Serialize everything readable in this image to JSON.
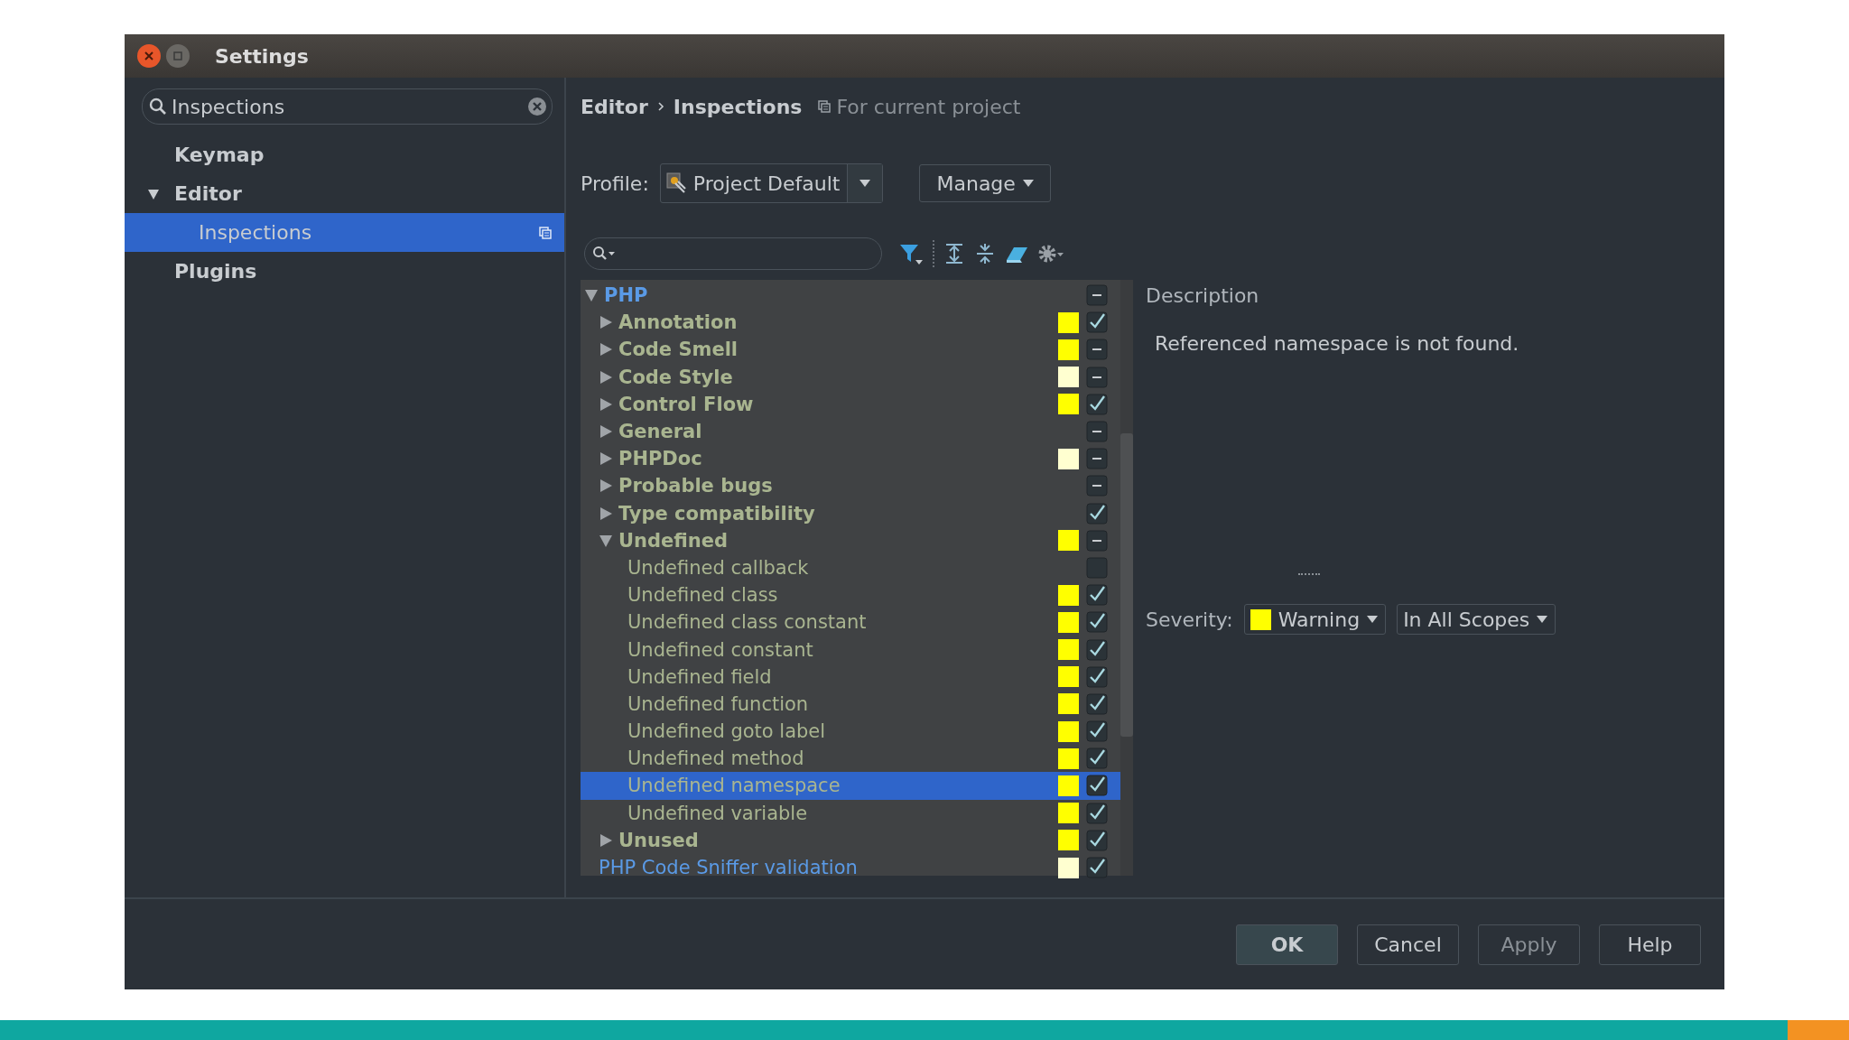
{
  "window": {
    "title": "Settings"
  },
  "sidebar": {
    "search": {
      "value": "Inspections"
    },
    "items": [
      {
        "label": "Keymap",
        "selected": false
      },
      {
        "label": "Editor",
        "selected": false,
        "expanded": true,
        "children": [
          {
            "label": "Inspections",
            "selected": true
          }
        ]
      },
      {
        "label": "Plugins",
        "selected": false
      }
    ]
  },
  "breadcrumb": [
    "Editor",
    "Inspections"
  ],
  "scope_note": "For current project",
  "profile": {
    "label": "Profile:",
    "value": "Project Default"
  },
  "manage_button": "Manage",
  "tree": [
    {
      "label": "PHP",
      "modified": true,
      "expanded": true,
      "checked": false,
      "partial": true,
      "selected": false,
      "children": [
        {
          "label": "Annotation",
          "modified": false,
          "expanded": false,
          "color": "#ffff00",
          "checked": true,
          "selected": false
        },
        {
          "label": "Code Smell",
          "modified": false,
          "expanded": false,
          "color": "#ffff00",
          "checked": false,
          "partial": true,
          "selected": false
        },
        {
          "label": "Code Style",
          "modified": false,
          "expanded": false,
          "color": "#ffffd0",
          "checked": false,
          "partial": true,
          "selected": false
        },
        {
          "label": "Control Flow",
          "modified": false,
          "expanded": false,
          "color": "#ffff00",
          "checked": true,
          "selected": false
        },
        {
          "label": "General",
          "modified": false,
          "expanded": false,
          "checked": false,
          "partial": true,
          "selected": false
        },
        {
          "label": "PHPDoc",
          "modified": false,
          "expanded": false,
          "color": "#ffffd0",
          "checked": false,
          "partial": true,
          "selected": false
        },
        {
          "label": "Probable bugs",
          "modified": false,
          "expanded": false,
          "checked": false,
          "partial": true,
          "selected": false
        },
        {
          "label": "Type compatibility",
          "modified": false,
          "expanded": false,
          "checked": true,
          "selected": false
        },
        {
          "label": "Undefined",
          "modified": false,
          "expanded": true,
          "color": "#ffff00",
          "checked": false,
          "partial": true,
          "selected": false,
          "children": [
            {
              "label": "Undefined callback",
              "modified": false,
              "checked": false,
              "partial": false,
              "selected": false
            },
            {
              "label": "Undefined class",
              "modified": false,
              "color": "#ffff00",
              "checked": true,
              "selected": false
            },
            {
              "label": "Undefined class constant",
              "modified": false,
              "color": "#ffff00",
              "checked": true,
              "selected": false
            },
            {
              "label": "Undefined constant",
              "modified": false,
              "color": "#ffff00",
              "checked": true,
              "selected": false
            },
            {
              "label": "Undefined field",
              "modified": false,
              "color": "#ffff00",
              "checked": true,
              "selected": false
            },
            {
              "label": "Undefined function",
              "modified": false,
              "color": "#ffff00",
              "checked": true,
              "selected": false
            },
            {
              "label": "Undefined goto label",
              "modified": false,
              "color": "#ffff00",
              "checked": true,
              "selected": false
            },
            {
              "label": "Undefined method",
              "modified": false,
              "color": "#ffff00",
              "checked": true,
              "selected": false
            },
            {
              "label": "Undefined namespace",
              "modified": false,
              "color": "#ffff00",
              "checked": true,
              "selected": true
            },
            {
              "label": "Undefined variable",
              "modified": false,
              "color": "#ffff00",
              "checked": true,
              "selected": false
            }
          ]
        },
        {
          "label": "Unused",
          "modified": false,
          "expanded": false,
          "color": "#ffff00",
          "checked": true,
          "selected": false
        }
      ]
    },
    {
      "label": "PHP Code Sniffer validation",
      "modified": true,
      "color": "#ffffd0",
      "checked": true,
      "selected": false
    }
  ],
  "description": {
    "heading": "Description",
    "text": "Referenced namespace is not found."
  },
  "severity": {
    "label": "Severity:",
    "value": "Warning",
    "color": "#ffff00",
    "scope": "In All Scopes"
  },
  "buttons": [
    {
      "label": "OK",
      "default": true,
      "disabled": false
    },
    {
      "label": "Cancel",
      "default": false,
      "disabled": false
    },
    {
      "label": "Apply",
      "default": false,
      "disabled": true
    },
    {
      "label": "Help",
      "default": false,
      "disabled": false
    }
  ]
}
